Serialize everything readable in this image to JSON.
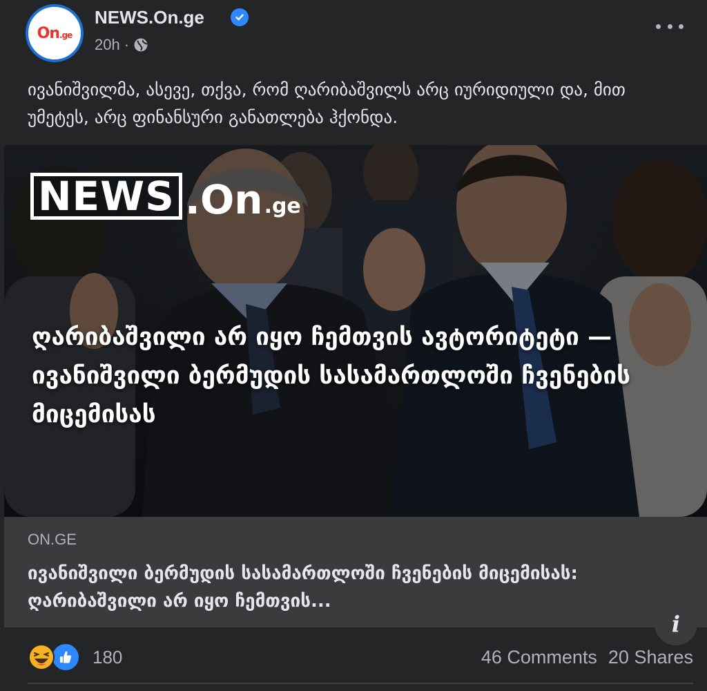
{
  "header": {
    "avatar_logo_main": "On",
    "avatar_logo_suffix": ".ge",
    "page_name": "NEWS.On.ge",
    "time": "20h",
    "separator": "·"
  },
  "post": {
    "text": "ივანიშვილმა, ასევე, თქვა, რომ ღარიბაშვილს არც იურიდიული და, მით უმეტეს, არც ფინანსური განათლება ჰქონდა."
  },
  "media": {
    "logo_news": "NEWS",
    "logo_on": ".On",
    "logo_ge": ".ge",
    "headline": "ღარიბაშვილი არ იყო ჩემთვის ავტორიტეტი — ივანიშვილი ბერმუდის სასამართლოში ჩვენების მიცემისას",
    "info_label": "i"
  },
  "link_preview": {
    "domain": "ON.GE",
    "title": "ივანიშვილი ბერმუდის სასამართლოში ჩვენების მიცემისას: ღარიბაშვილი არ იყო ჩემთვის..."
  },
  "footer": {
    "reaction_count": "180",
    "comments": "46 Comments",
    "shares": "20 Shares"
  },
  "colors": {
    "background": "#242526",
    "preview_bg": "#3a3b3c",
    "verified": "#2d88ff",
    "secondary_text": "#b0b3b8",
    "avatar_ring": "#1d6fd6",
    "avatar_logo": "#e8332a"
  },
  "icons": [
    "verified-icon",
    "globe-icon",
    "more-icon",
    "info-icon",
    "haha-icon",
    "like-icon"
  ]
}
